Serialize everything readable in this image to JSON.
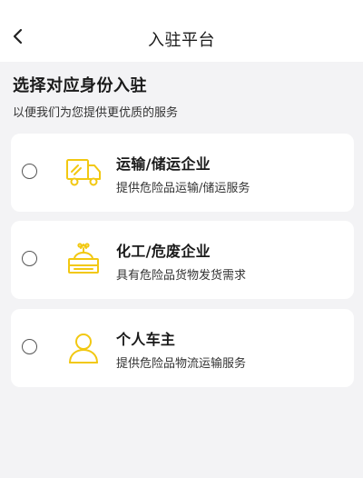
{
  "header": {
    "title": "入驻平台"
  },
  "intro": {
    "title": "选择对应身份入驻",
    "subtitle": "以便我们为您提供更优质的服务"
  },
  "accent_color": "#F2C811",
  "options": [
    {
      "title": "运输/储运企业",
      "description": "提供危险品运输/储运服务",
      "icon": "truck-icon",
      "selected": false
    },
    {
      "title": "化工/危废企业",
      "description": "具有危险品货物发货需求",
      "icon": "chemical-warehouse-icon",
      "selected": false
    },
    {
      "title": "个人车主",
      "description": "提供危险品物流运输服务",
      "icon": "person-icon",
      "selected": false
    }
  ]
}
